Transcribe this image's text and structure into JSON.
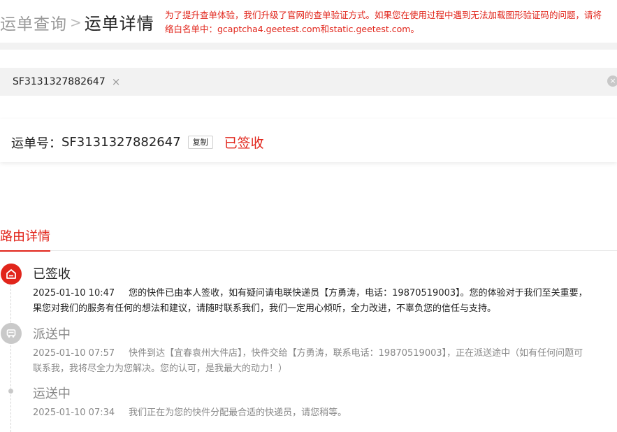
{
  "breadcrumb": {
    "query": "运单查询",
    "separator": ">",
    "detail": "运单详情"
  },
  "notice": {
    "line1": "为了提升查单体验，我们升级了官网的查单验证方式。如果您在使用过程中遇到无法加载图形验证码的问题，请将",
    "line2": "络白名单中：gcaptcha4.geetest.com和static.geetest.com。"
  },
  "search": {
    "tag": "SF3131327882647",
    "tag_remove": "×",
    "clear": "×"
  },
  "waybill": {
    "label": "运单号：",
    "number": "SF3131327882647",
    "copy": "复制",
    "status": "已签收"
  },
  "tabs": {
    "route": "路由详情"
  },
  "events": [
    {
      "title": "已签收",
      "time": "2025-01-10 10:47",
      "line1": "您的快件已由本人签收，如有疑问请电联快递员【方勇涛，电话：19870519003】。您的体验对于我们至关重要，",
      "line2": "果您对我们的服务有任何的想法和建议，请随时联系我们，我们一定用心倾听，全力改进，不辜负您的信任与支持。"
    },
    {
      "title": "派送中",
      "time": "2025-01-10 07:57",
      "line1": "快件到达【宜春袁州大件店】，快件交给【方勇涛，联系电话：19870519003】，正在派送途中（如有任何问题可",
      "line2": "联系我，我将尽全力为您解决。您的认可，是我最大的动力！）"
    },
    {
      "title": "运送中",
      "time": "2025-01-10 07:34",
      "line1": "我们正在为您的快件分配最合适的快递员，请您稍等。"
    }
  ],
  "colors": {
    "accent": "#e1251b",
    "muted": "#888888"
  }
}
